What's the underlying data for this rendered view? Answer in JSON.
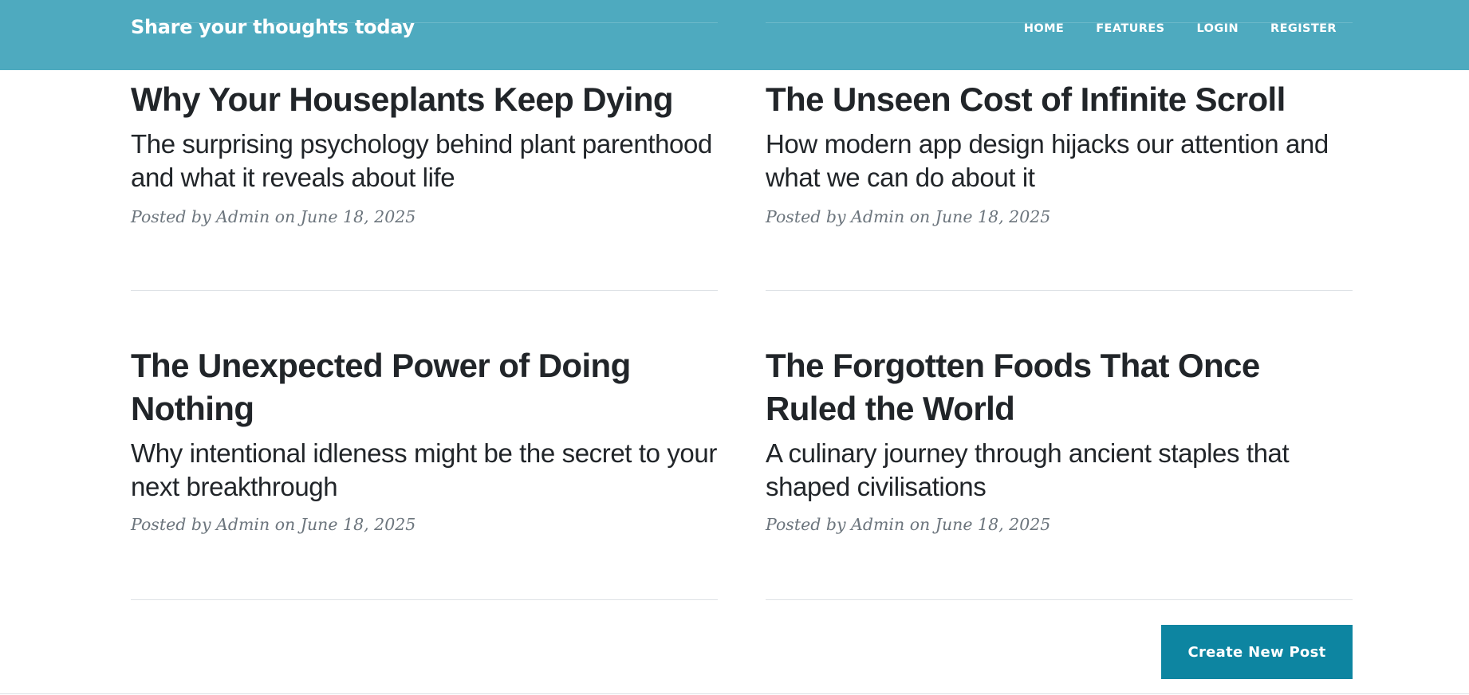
{
  "navbar": {
    "brand": "Share your thoughts today",
    "links": [
      "HOME",
      "FEATURES",
      "LOGIN",
      "REGISTER"
    ],
    "background_color": "#4eaabf"
  },
  "posts": [
    {
      "title": "Why Your Houseplants Keep Dying",
      "subtitle": "The surprising psychology behind plant parenthood and what it reveals about life",
      "meta": "Posted by Admin on June 18, 2025"
    },
    {
      "title": "The Unseen Cost of Infinite Scroll",
      "subtitle": "How modern app design hijacks our attention and what we can do about it",
      "meta": "Posted by Admin on June 18, 2025"
    },
    {
      "title": "The Unexpected Power of Doing Nothing",
      "subtitle": "Why intentional idleness might be the secret to your next breakthrough",
      "meta": "Posted by Admin on June 18, 2025"
    },
    {
      "title": "The Forgotten Foods That Once Ruled the World",
      "subtitle": "A culinary journey through ancient staples that shaped civilisations",
      "meta": "Posted by Admin on June 18, 2025"
    }
  ],
  "actions": {
    "create_post_label": "Create New Post",
    "button_color": "#0d85a1"
  }
}
